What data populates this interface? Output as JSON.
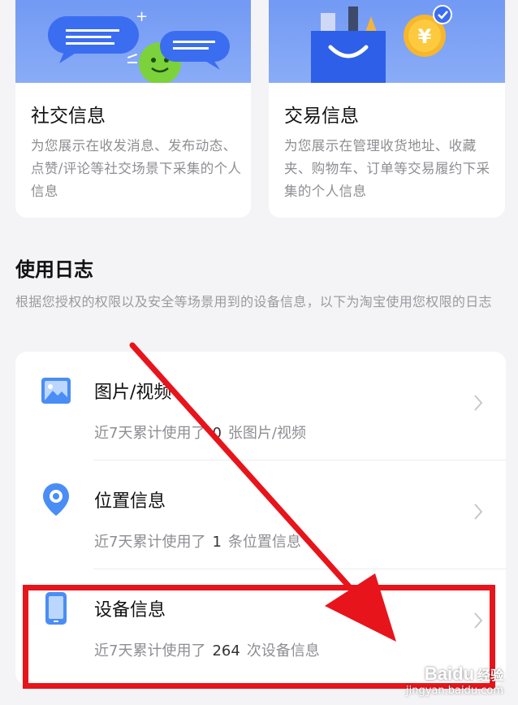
{
  "cards": [
    {
      "title": "社交信息",
      "desc": "为您展示在收发消息、发布动态、点赞/评论等社交场景下采集的个人信息",
      "icon": "chat-bubbles-icon"
    },
    {
      "title": "交易信息",
      "desc": "为您展示在管理收货地址、收藏夹、购物车、订单等交易履约下采集的个人信息",
      "icon": "shopping-bag-yuan-icon"
    }
  ],
  "usage_log": {
    "title": "使用日志",
    "desc": "根据您授权的权限以及安全等场景用到的设备信息，以下为淘宝使用您权限的日志",
    "items": [
      {
        "title": "图片/视频",
        "prefix": "近7天累计使用了",
        "count": "0",
        "suffix": "张图片/视频",
        "icon": "image-icon"
      },
      {
        "title": "位置信息",
        "prefix": "近7天累计使用了",
        "count": "1",
        "suffix": "条位置信息",
        "icon": "location-pin-icon"
      },
      {
        "title": "设备信息",
        "prefix": "近7天累计使用了",
        "count": "264",
        "suffix": "次设备信息",
        "icon": "phone-icon"
      }
    ]
  },
  "watermark": {
    "logo": "Baidu",
    "logo_cn": "经验",
    "url": "jingyan.baidu.com"
  },
  "colors": {
    "accent_blue": "#6f97f3",
    "highlight_red": "#e8141b"
  }
}
